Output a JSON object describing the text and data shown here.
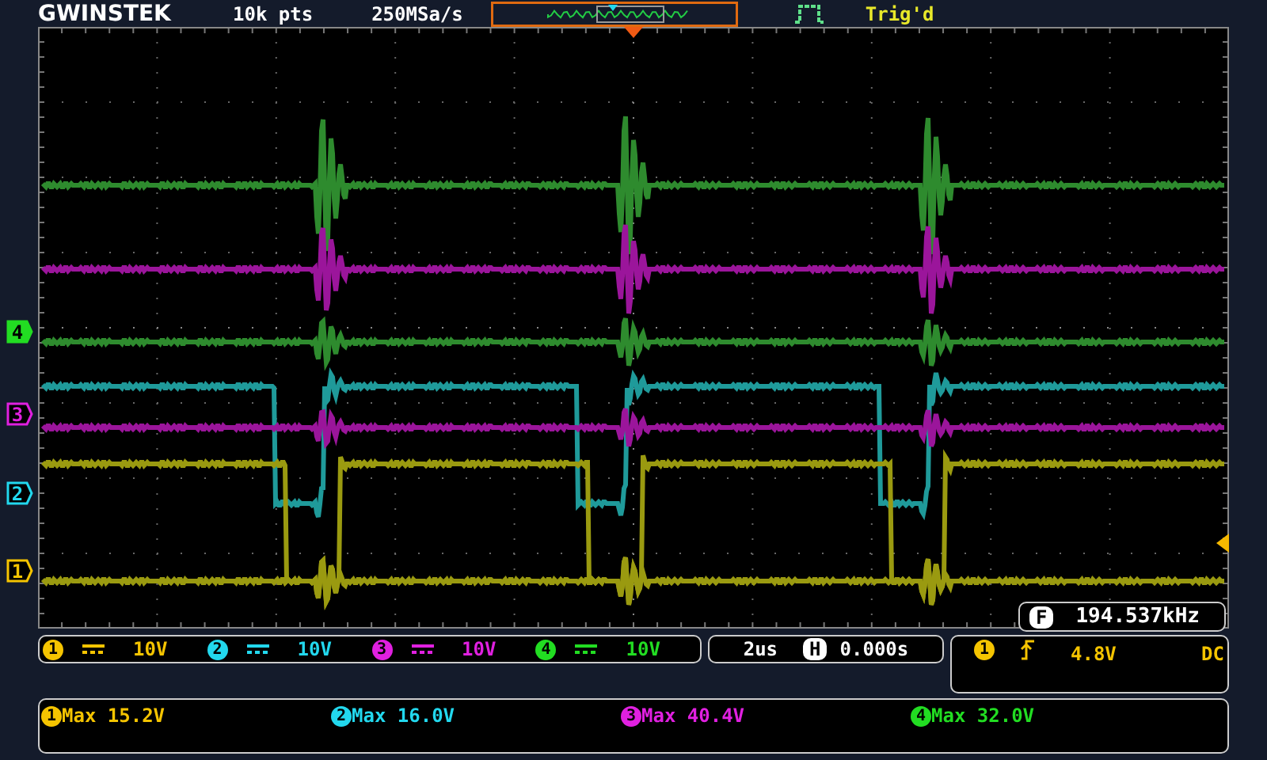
{
  "header": {
    "logo": "GWINSTEK",
    "record_length": "10k pts",
    "sample_rate": "250MSa/s",
    "trigger_status": "Trig'd"
  },
  "channel_markers": [
    {
      "label": "4",
      "color": "#22dd22",
      "selected": true
    },
    {
      "label": "3",
      "color": "#e020e0",
      "selected": false
    },
    {
      "label": "2",
      "color": "#22d8ee",
      "selected": false
    },
    {
      "label": "1",
      "color": "#f5c400",
      "selected": false
    }
  ],
  "frequency_counter": {
    "badge": "F",
    "value": "194.537kHz"
  },
  "channel_scales": [
    {
      "badge": "1",
      "color": "#f5c400",
      "scale": "10V"
    },
    {
      "badge": "2",
      "color": "#22d8ee",
      "scale": "10V"
    },
    {
      "badge": "3",
      "color": "#e020e0",
      "scale": "10V"
    },
    {
      "badge": "4",
      "color": "#22dd22",
      "scale": "10V"
    }
  ],
  "timebase": {
    "scale": "2us",
    "position_badge": "H",
    "position": "0.000s"
  },
  "trigger": {
    "source": "1",
    "color": "#f5c400",
    "level": "4.8V",
    "coupling": "DC"
  },
  "measurements": [
    {
      "badge": "1",
      "color": "#f5c400",
      "text": "Max 15.2V"
    },
    {
      "badge": "2",
      "color": "#22d8ee",
      "text": "Max 16.0V"
    },
    {
      "badge": "3",
      "color": "#e020e0",
      "text": "Max 40.4V"
    },
    {
      "badge": "4",
      "color": "#22dd22",
      "text": "Max 32.0V"
    }
  ]
}
